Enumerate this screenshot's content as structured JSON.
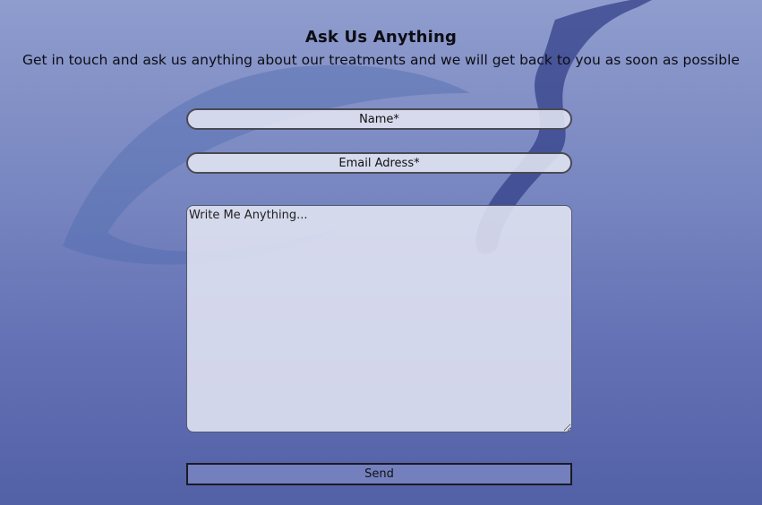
{
  "heading": {
    "title": "Ask Us Anything",
    "subtitle": "Get in touch and ask us anything about our treatments and we will get back to you as soon as possible"
  },
  "form": {
    "name_placeholder": "Name*",
    "email_placeholder": "Email Adress*",
    "message_placeholder": "Write Me Anything...",
    "send_label": "Send"
  },
  "colors": {
    "background_top": "#8f9ccd",
    "background_bottom": "#5260a6",
    "swoosh_light": "#4f6cb0",
    "swoosh_dark": "#2e3a85",
    "field_fill": "#e2e5f2",
    "button_fill": "#7380bd"
  },
  "icons": {
    "background_logo": "swoosh-logo"
  }
}
